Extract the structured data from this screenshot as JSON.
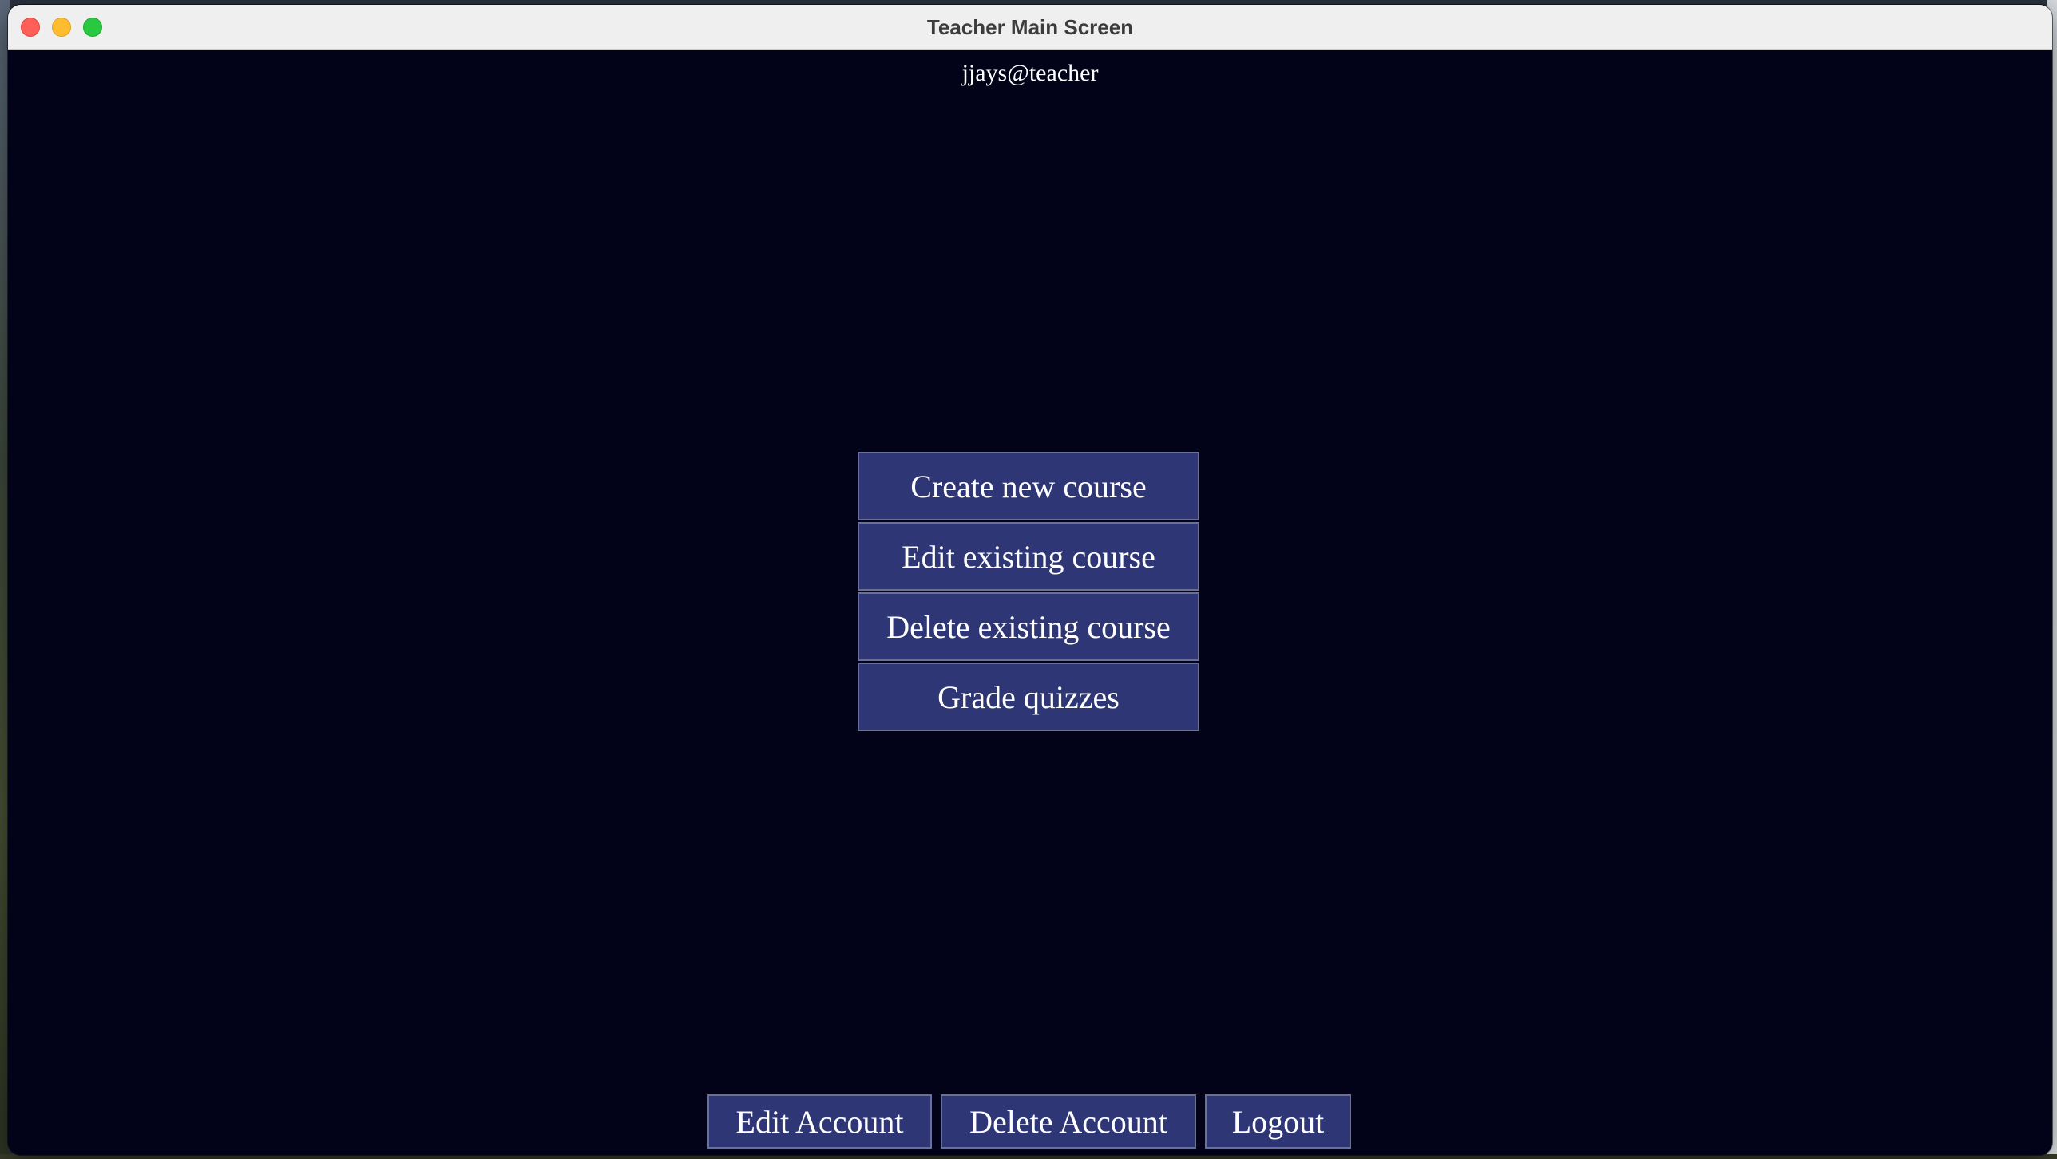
{
  "window": {
    "title": "Teacher Main Screen"
  },
  "header": {
    "username": "jjays@teacher"
  },
  "menu": {
    "items": [
      {
        "label": "Create new course"
      },
      {
        "label": "Edit existing course"
      },
      {
        "label": "Delete existing course"
      },
      {
        "label": "Grade quizzes"
      }
    ]
  },
  "footer": {
    "edit_account_label": "Edit Account",
    "delete_account_label": "Delete Account",
    "logout_label": "Logout"
  },
  "colors": {
    "background": "#020318",
    "button": "#2e3675",
    "button_border": "#6a7096",
    "text": "#ffffff"
  }
}
